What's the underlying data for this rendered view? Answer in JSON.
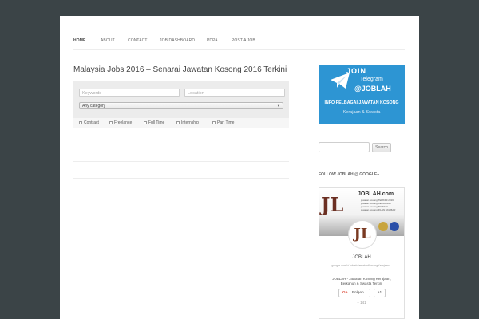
{
  "nav": {
    "items": [
      "HOME",
      "ABOUT",
      "CONTACT",
      "JOB DASHBOARD",
      "PDPA",
      "POST A JOB"
    ]
  },
  "main": {
    "title": "Malaysia Jobs 2016 – Senarai Jawatan Kosong 2016 Terkini",
    "search": {
      "keywords_placeholder": "Keywords",
      "location_placeholder": "Location",
      "category_value": "Any category",
      "job_types": [
        "Contract",
        "Freelance",
        "Full Time",
        "Internship",
        "Part Time"
      ]
    }
  },
  "sidebar": {
    "banner": {
      "join": "JOIN",
      "telegram": "Telegram",
      "handle": "@JOBLAH",
      "info": "INFO PELBAGAI JAWATAN KOSONG",
      "sub": "Kerajaan & Swasta"
    },
    "search_button": "Search",
    "widget_title": "FOLLOW JOBLAH @ GOOGLE+",
    "gplus": {
      "cover_brand": "JOBLAH.com",
      "cover_lines": [
        "jawatan kosong TERKINI 2016",
        "jawatan kosong KERAJAAN",
        "jawatan kosong SWASTA",
        "jawatan kosong IKLAN AKHBAR"
      ],
      "name": "JOBLAH",
      "url": "google.com/+JoblahJawatanKosongKerajaan...",
      "description": "JOBLAH - Jawatan Kosong Kerajaan, Berkanun & Swasta Terkini",
      "follow_label": "Folgen",
      "plusone_label": "+1",
      "count": "+ 141"
    }
  }
}
